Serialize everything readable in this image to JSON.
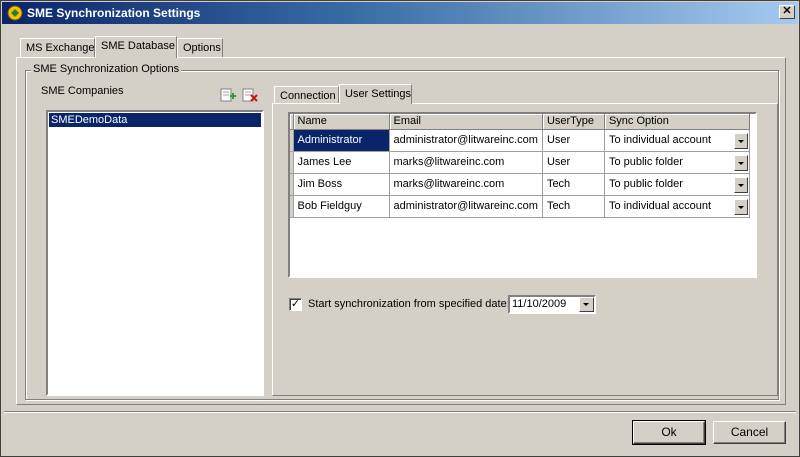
{
  "window": {
    "title": "SME Synchronization Settings",
    "close_glyph": "✕"
  },
  "main_tabs": [
    {
      "label": "MS Exchange"
    },
    {
      "label": "SME Database"
    },
    {
      "label": "Options"
    }
  ],
  "sync_options": {
    "group_title": "SME Synchronization Options",
    "companies_label": "SME Companies",
    "companies": [
      "SMEDemoData"
    ],
    "selected_company": "SMEDemoData"
  },
  "inner_tabs": [
    {
      "label": "Connection"
    },
    {
      "label": "User Settings"
    }
  ],
  "users_grid": {
    "columns": [
      "Name",
      "Email",
      "UserType",
      "Sync Option"
    ],
    "rows": [
      {
        "name": "Administrator",
        "email": "administrator@litwareinc.com",
        "user_type": "User",
        "sync_option": "To individual account"
      },
      {
        "name": "James Lee",
        "email": "marks@litwareinc.com",
        "user_type": "User",
        "sync_option": "To public folder"
      },
      {
        "name": "Jim Boss",
        "email": "marks@litwareinc.com",
        "user_type": "Tech",
        "sync_option": "To public folder"
      },
      {
        "name": "Bob Fieldguy",
        "email": "administrator@litwareinc.com",
        "user_type": "Tech",
        "sync_option": "To individual account"
      }
    ]
  },
  "start_sync": {
    "checked": true,
    "check_glyph": "✓",
    "label": "Start synchronization from specified date:",
    "date": "11/10/2009"
  },
  "footer": {
    "ok_label": "Ok",
    "cancel_label": "Cancel"
  },
  "colors": {
    "selection": "#0a246a",
    "dialog_bg": "#d4d0c8",
    "title_gradient_start": "#0a246a"
  }
}
